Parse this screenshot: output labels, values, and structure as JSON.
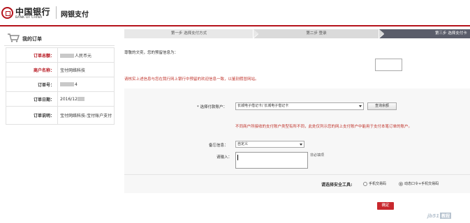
{
  "header": {
    "bank_name_cn": "中国银行",
    "bank_name_en": "BANK OF CHINA",
    "app_title": "网银支付"
  },
  "sidebar": {
    "title": "我的订单",
    "rows": [
      {
        "key": "订单总额：",
        "value": "人民币元",
        "highlight": true
      },
      {
        "key": "商户名称：",
        "value": "宝付网络科技",
        "highlight": true
      },
      {
        "key": "订单号：",
        "value": "4",
        "highlight": false
      },
      {
        "key": "订单日期：",
        "value": "2016/12",
        "highlight": false
      },
      {
        "key": "订单说明：",
        "value": "宝付网络科技-宝付账户支付",
        "highlight": false
      }
    ]
  },
  "steps": {
    "step1": "第一步  选择支付方式",
    "step2": "第二步  登录",
    "step3": "第三步  选择支付卡"
  },
  "main": {
    "greeting": "尊敬的文奕，您的预留信息为：",
    "warning_reserved": "请核实上述信息与您在我行网上银行中预留的欢迎信息一致，以鉴别假冒网站。",
    "account_label": "*  选择付款账户：",
    "account_value": "长城电子借记卡/         长城电子借记卡",
    "query_balance": "查询余额",
    "account_warning": "不同商户所接收的支付账户类型有所不同，此处仅列示您的网上支付账户中能用于支付本笔订单的账户。",
    "memo_label": "备忘信息：",
    "memo_option": "自定义",
    "memo_input_label": "请输入：",
    "memo_optional": "非必填项",
    "security_label": "请选择安全工具:",
    "security_options": [
      "手机交易码",
      "动态口令+手机交易码"
    ],
    "confirm": "确定"
  },
  "watermark": {
    "text": "jb51",
    "tag": "教程"
  },
  "colors": {
    "brand_red": "#b5121b",
    "warning_red": "#c0352d",
    "active_step": "#5a5d6a",
    "confirm_button": "#c8282e"
  }
}
